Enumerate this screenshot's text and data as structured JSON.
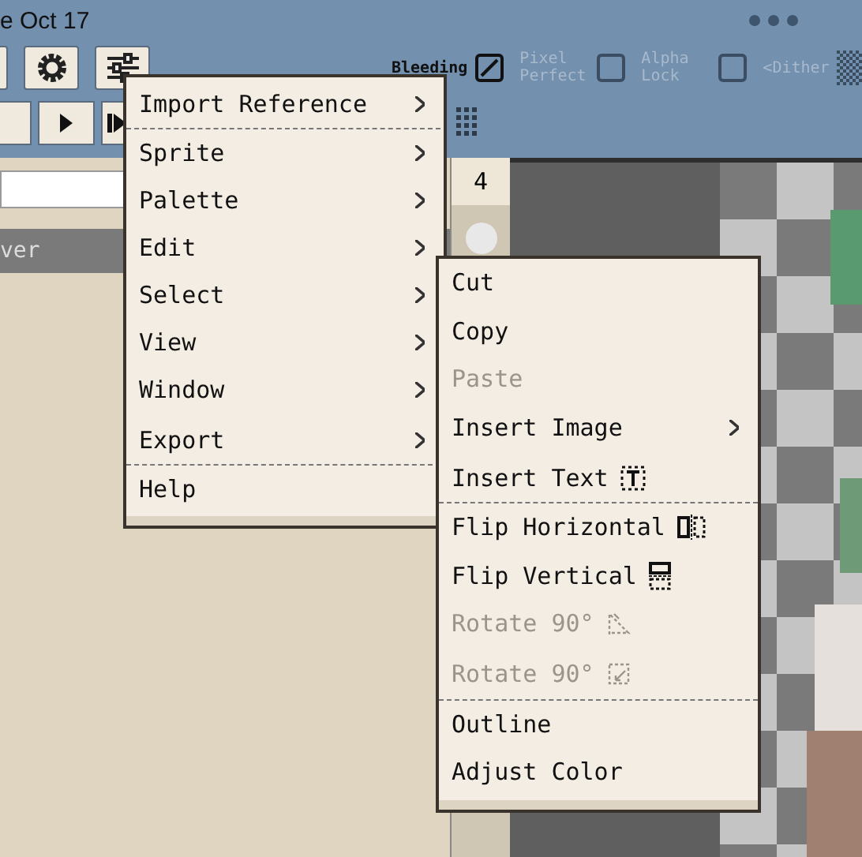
{
  "status_bar": {
    "date": "e Oct 17"
  },
  "toolbar": {
    "options": [
      {
        "kind": "checkbox",
        "label": "Bleeding",
        "checked": true,
        "disabled": false
      },
      {
        "kind": "checkbox",
        "label": "Pixel Perfect",
        "checked": false,
        "disabled": true
      },
      {
        "kind": "checkbox",
        "label": "Alpha Lock",
        "checked": false,
        "disabled": true
      },
      {
        "kind": "pattern",
        "label": "<Dither",
        "disabled": true
      }
    ]
  },
  "frames": {
    "current": "4"
  },
  "layers": {
    "items": [
      {
        "name": "ver",
        "selected": true
      }
    ]
  },
  "menu": {
    "items": [
      {
        "label": "Import Reference",
        "submenu": true,
        "divider_after": true
      },
      {
        "label": "Sprite",
        "submenu": true,
        "divider_after": false
      },
      {
        "label": "Palette",
        "submenu": true,
        "divider_after": false
      },
      {
        "label": "Edit",
        "submenu": true,
        "divider_after": false
      },
      {
        "label": "Select",
        "submenu": true,
        "divider_after": false
      },
      {
        "label": "View",
        "submenu": true,
        "divider_after": false
      },
      {
        "label": "Window",
        "submenu": true,
        "divider_after": false
      },
      {
        "label": "Export",
        "submenu": true,
        "divider_after": true
      },
      {
        "label": "Help",
        "submenu": false,
        "divider_after": false
      }
    ]
  },
  "submenu": {
    "items": [
      {
        "kind": "plain",
        "label": "Cut",
        "disabled": false,
        "submenu": false,
        "divider_after": false
      },
      {
        "kind": "plain",
        "label": "Copy",
        "disabled": false,
        "submenu": false,
        "divider_after": false
      },
      {
        "kind": "plain",
        "label": "Paste",
        "disabled": true,
        "submenu": false,
        "divider_after": false
      },
      {
        "kind": "plain",
        "label": "Insert Image",
        "disabled": false,
        "submenu": true,
        "divider_after": false
      },
      {
        "kind": "text",
        "label": "Insert Text",
        "disabled": false,
        "submenu": false,
        "divider_after": true
      },
      {
        "kind": "fliph",
        "label": "Flip Horizontal",
        "disabled": false,
        "submenu": false,
        "divider_after": false
      },
      {
        "kind": "flipv",
        "label": "Flip Vertical",
        "disabled": false,
        "submenu": false,
        "divider_after": false
      },
      {
        "kind": "rotatecw",
        "label": "Rotate 90°",
        "disabled": true,
        "submenu": false,
        "divider_after": false
      },
      {
        "kind": "rotateccw",
        "label": "Rotate 90°",
        "disabled": true,
        "submenu": false,
        "divider_after": true
      },
      {
        "kind": "plain",
        "label": "Outline",
        "disabled": false,
        "submenu": false,
        "divider_after": false
      },
      {
        "kind": "plain",
        "label": "Adjust Color",
        "disabled": false,
        "submenu": false,
        "divider_after": false
      }
    ]
  }
}
